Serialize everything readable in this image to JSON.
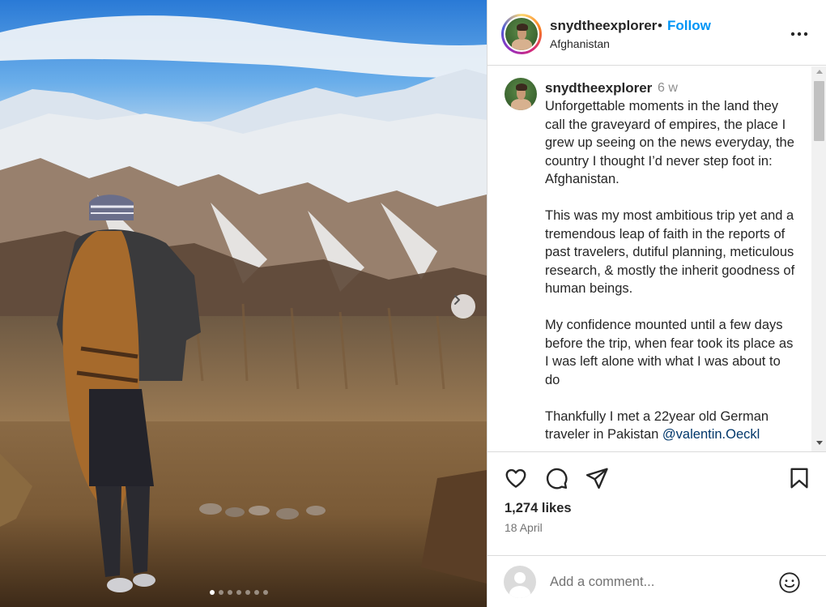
{
  "post": {
    "username": "snydtheexplorer",
    "bullet": "•",
    "follow_label": "Follow",
    "location": "Afghanistan",
    "more_icon": "more-horizontal-icon"
  },
  "caption": {
    "username": "snydtheexplorer",
    "time": "6 w",
    "paragraphs": [
      "Unforgettable moments in the land they call the graveyard of empires, the place I grew up seeing on the news everyday, the country I thought I’d never step foot in: Afghanistan.",
      "This was my most ambitious trip yet and a tremendous leap of faith in the reports of past travelers, dutiful planning, meticulous research, & mostly the inherit goodness of human beings.",
      "My confidence mounted until a few days before the trip, when fear took its place as I was left alone with what I was about to do",
      "Thankfully I met a 22year old German traveler in Pakistan"
    ],
    "mention": "@valentin.Oeckl"
  },
  "actions": {
    "like_icon": "heart-icon",
    "comment_icon": "comment-icon",
    "share_icon": "send-icon",
    "save_icon": "bookmark-icon",
    "likes": "1,274 likes",
    "date": "18 April"
  },
  "comment": {
    "placeholder": "Add a comment...",
    "emoji_icon": "emoji-icon"
  },
  "carousel": {
    "slide_count": 7,
    "active_index": 0
  }
}
